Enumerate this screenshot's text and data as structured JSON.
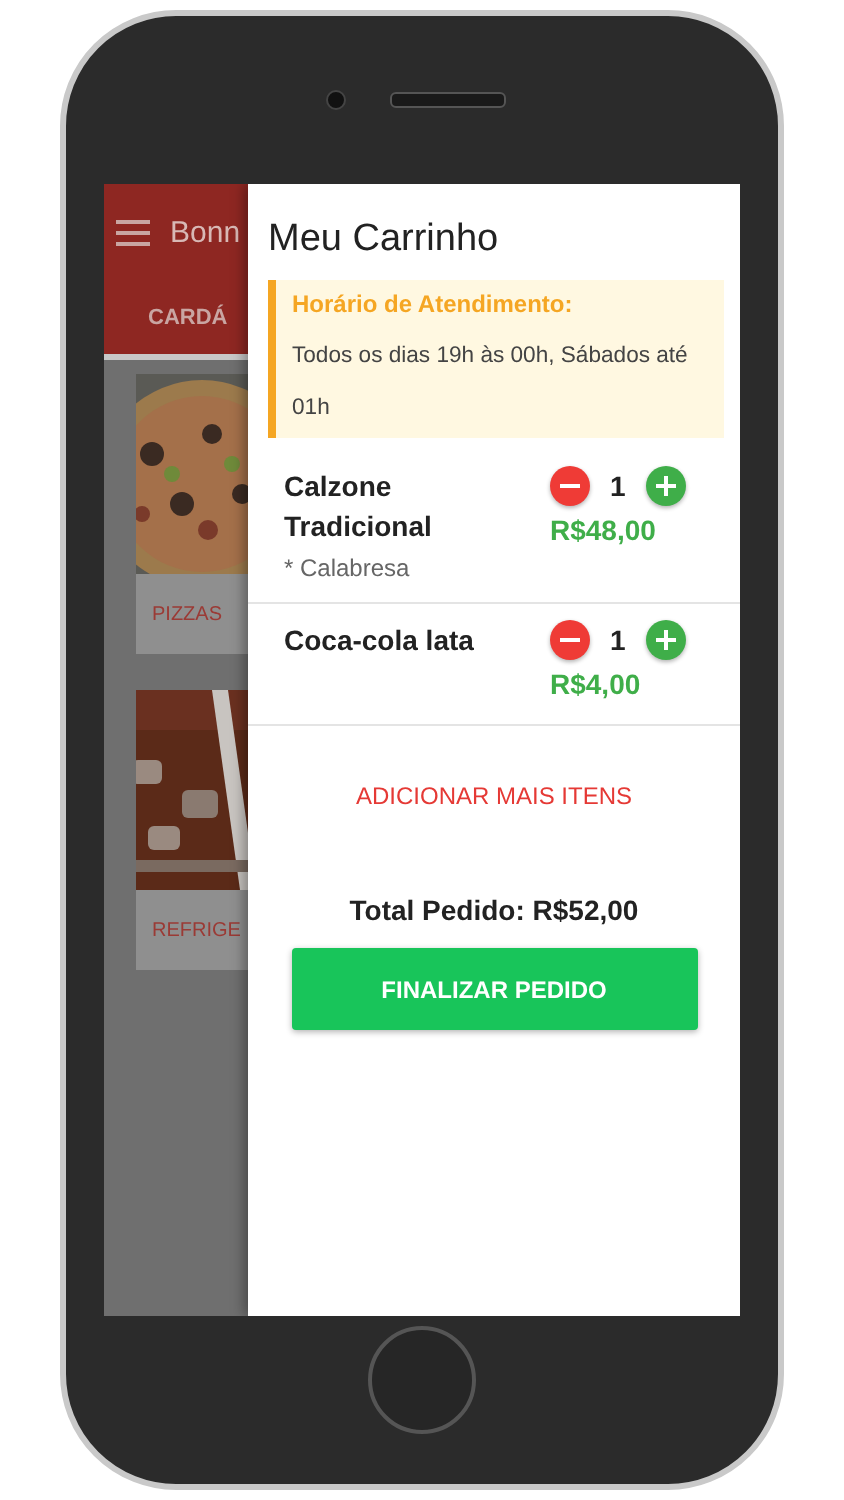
{
  "background_app": {
    "header": {
      "title": "Bonn"
    },
    "tabs": [
      {
        "label": "CARDÁ",
        "selected": true
      }
    ],
    "categories": [
      {
        "label": "PIZZAS",
        "kind": "pizza"
      },
      {
        "label": "REFRIGE",
        "kind": "drink"
      }
    ]
  },
  "cart": {
    "title": "Meu Carrinho",
    "notice": {
      "title": "Horário de Atendimento:",
      "text": "Todos os dias 19h às 00h, Sábados até 01h"
    },
    "items": [
      {
        "name": "Calzone Tradicional",
        "note": "* Calabresa",
        "quantity": "1",
        "price": "R$48,00"
      },
      {
        "name": "Coca-cola lata",
        "quantity": "1",
        "price": "R$4,00"
      }
    ],
    "add_more": "ADICIONAR MAIS ITENS",
    "total": "Total Pedido: R$52,00",
    "checkout": "FINALIZAR PEDIDO"
  }
}
